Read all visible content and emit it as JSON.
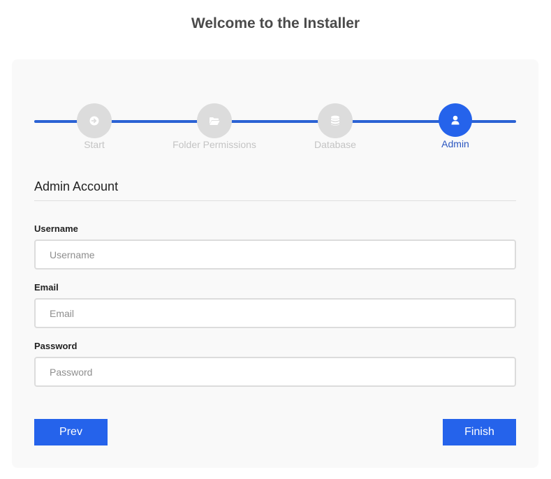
{
  "page": {
    "title": "Welcome to the Installer"
  },
  "steps": [
    {
      "label": "Start",
      "icon": "arrow-right-circle-icon",
      "active": false
    },
    {
      "label": "Folder Permissions",
      "icon": "folder-open-icon",
      "active": false
    },
    {
      "label": "Database",
      "icon": "database-icon",
      "active": false
    },
    {
      "label": "Admin",
      "icon": "user-icon",
      "active": true
    }
  ],
  "form": {
    "section_title": "Admin Account",
    "username": {
      "label": "Username",
      "placeholder": "Username",
      "value": ""
    },
    "email": {
      "label": "Email",
      "placeholder": "Email",
      "value": ""
    },
    "password": {
      "label": "Password",
      "placeholder": "Password",
      "value": ""
    }
  },
  "buttons": {
    "prev": "Prev",
    "finish": "Finish"
  },
  "colors": {
    "accent": "#2563eb",
    "track": "#2b62d4",
    "inactive_step": "#dcdcdc",
    "inactive_label": "#c4c4c4",
    "card_background": "#f9f9f9"
  }
}
